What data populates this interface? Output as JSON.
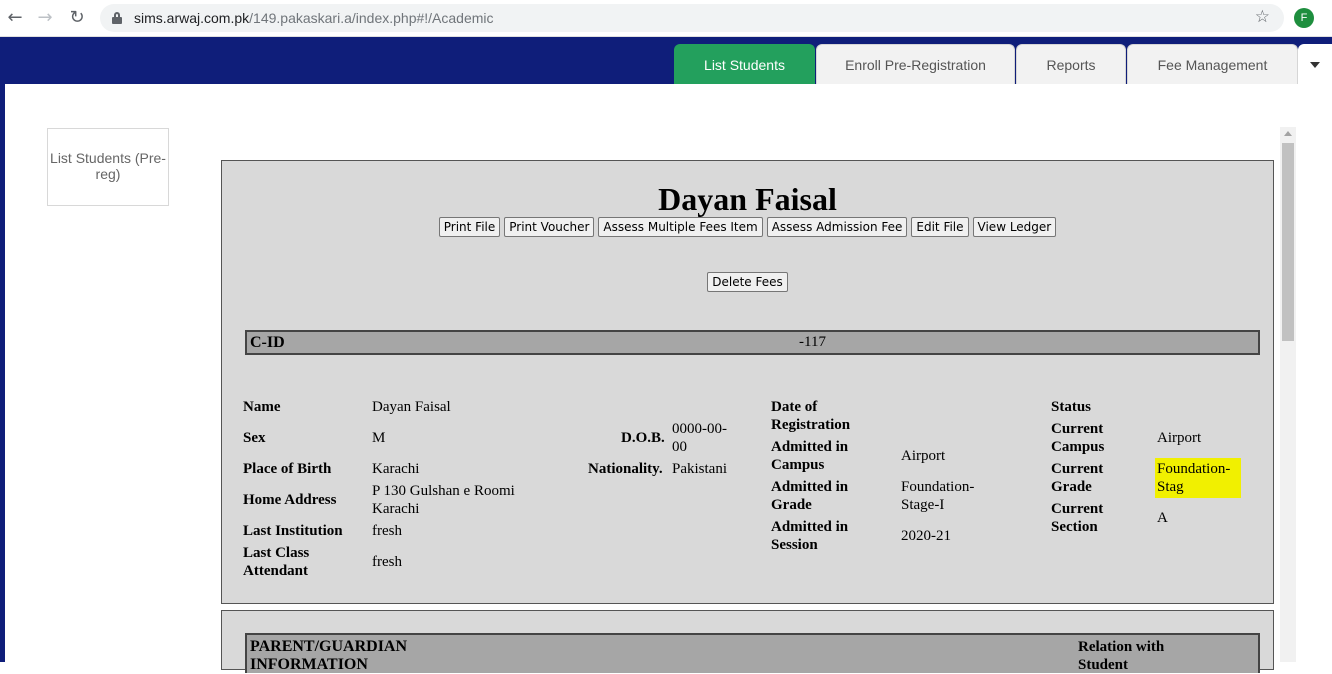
{
  "browser": {
    "url_host": "sims.arwaj.com.pk",
    "url_path": "/149.pakaskari.a/index.php#!/Academic",
    "profile_initial": "F",
    "icons": [
      "back-icon",
      "forward-icon",
      "reload-icon",
      "lock-icon",
      "star-icon"
    ]
  },
  "tabs": [
    {
      "label": "List Students",
      "active": true
    },
    {
      "label": "Enroll Pre-Registration",
      "active": false
    },
    {
      "label": "Reports",
      "active": false
    },
    {
      "label": "Fee Management",
      "active": false
    }
  ],
  "sidebar": {
    "button_label": "List Students (Pre-reg)"
  },
  "student": {
    "name": "Dayan Faisal",
    "actions": [
      "Print File",
      "Print Voucher",
      "Assess Multiple Fees Item",
      "Assess Admission Fee",
      "Edit File",
      "View Ledger"
    ],
    "delete_label": "Delete Fees",
    "cid_label": "C-ID",
    "cid_value": "-117",
    "fields": {
      "name": {
        "label": "Name",
        "value": "Dayan Faisal"
      },
      "sex": {
        "label": "Sex",
        "value": "M"
      },
      "place_of_birth": {
        "label": "Place of Birth",
        "value": "Karachi"
      },
      "home_address": {
        "label": "Home Address",
        "value": "P 130 Gulshan e Roomi Karachi"
      },
      "last_institution": {
        "label": "Last Institution",
        "value": "fresh"
      },
      "last_class": {
        "label": "Last Class Attendant",
        "value": "fresh"
      },
      "dob": {
        "label": "D.O.B.",
        "value": "0000-00-00"
      },
      "nationality": {
        "label": "Nationality.",
        "value": "Pakistani"
      },
      "date_of_registration": {
        "label": "Date of Registration",
        "value": ""
      },
      "admitted_campus": {
        "label": "Admitted in Campus",
        "value": "Airport"
      },
      "admitted_grade": {
        "label": "Admitted in Grade",
        "value": "Foundation-Stage-I"
      },
      "admitted_session": {
        "label": "Admitted in Session",
        "value": "2020-21"
      },
      "status": {
        "label": "Status",
        "value": ""
      },
      "current_campus": {
        "label": "Current Campus",
        "value": "Airport"
      },
      "current_grade": {
        "label": "Current Grade",
        "value": "Foundation-Stag"
      },
      "current_section": {
        "label": "Current Section",
        "value": "A"
      }
    }
  },
  "parent": {
    "heading": "PARENT/GUARDIAN INFORMATION",
    "relation_heading": "Relation with Student"
  },
  "colors": {
    "nav": "#0f1e7a",
    "active_tab": "#23a05d",
    "highlight": "#f1f000"
  }
}
